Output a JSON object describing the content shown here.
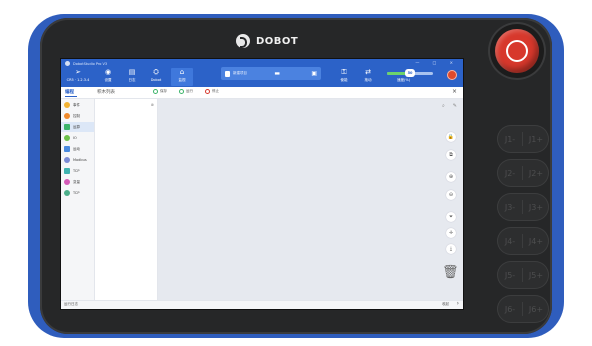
{
  "device": {
    "brand": "DOBOT",
    "bumper_color": "#2f5dbd",
    "body_color": "#262728",
    "estop_color": "#d7382c"
  },
  "app": {
    "title": "DobotStudio Pro V3",
    "accent": "#2c62c8",
    "window_controls": "— □ ×"
  },
  "toolbar": {
    "connection_label": "CR5 · 1.2.3.4",
    "items": [
      {
        "icon": "◉",
        "label": "设置"
      },
      {
        "icon": "▤",
        "label": "日志"
      },
      {
        "icon": "⛭",
        "label": "Dobot"
      },
      {
        "icon": "⌂",
        "label": "监视"
      }
    ],
    "project_name": "新建项目",
    "right_items": [
      {
        "icon": "⚿",
        "label": "使能"
      },
      {
        "icon": "⇄",
        "label": "拖动"
      }
    ],
    "speed": {
      "value": 50,
      "value_text": "50",
      "label": "速度(%)"
    }
  },
  "tabs": {
    "active": "编程",
    "blocks_list": "积木列表",
    "actions": [
      {
        "label": "保存",
        "color": "#3cb46a"
      },
      {
        "label": "运行",
        "color": "#3cb46a"
      },
      {
        "label": "停止",
        "color": "#d7382c"
      }
    ],
    "close": "×"
  },
  "categories": [
    {
      "label": "事件",
      "color": "#f2b233",
      "selected": false
    },
    {
      "label": "控制",
      "color": "#f08a2c",
      "selected": false
    },
    {
      "label": "运算",
      "color": "#3cb46a",
      "selected": true
    },
    {
      "label": "IO",
      "color": "#6cc24a",
      "selected": false
    },
    {
      "label": "运动",
      "color": "#4a8be0",
      "selected": false
    },
    {
      "label": "Modbus",
      "color": "#7a8bd6",
      "selected": false
    },
    {
      "label": "TCP",
      "color": "#3fb3b0",
      "selected": false
    },
    {
      "label": "变量",
      "color": "#d45ab8",
      "selected": false
    },
    {
      "label": "TCP",
      "color": "#4cae8a",
      "selected": false
    }
  ],
  "canvas_tools": {
    "top": [
      "⌕",
      "✎"
    ],
    "buttons": [
      "🔒",
      "⧉",
      "⊕",
      "⊖",
      "⏷",
      "✛",
      "⤓"
    ]
  },
  "bottom": {
    "left_label": "运行日志",
    "right_label": "收起",
    "chevron": "›"
  },
  "jog_keys": [
    [
      "J1-",
      "J1+"
    ],
    [
      "J2-",
      "J2+"
    ],
    [
      "J3-",
      "J3+"
    ],
    [
      "J4-",
      "J4+"
    ],
    [
      "J5-",
      "J5+"
    ],
    [
      "J6-",
      "J6+"
    ]
  ]
}
